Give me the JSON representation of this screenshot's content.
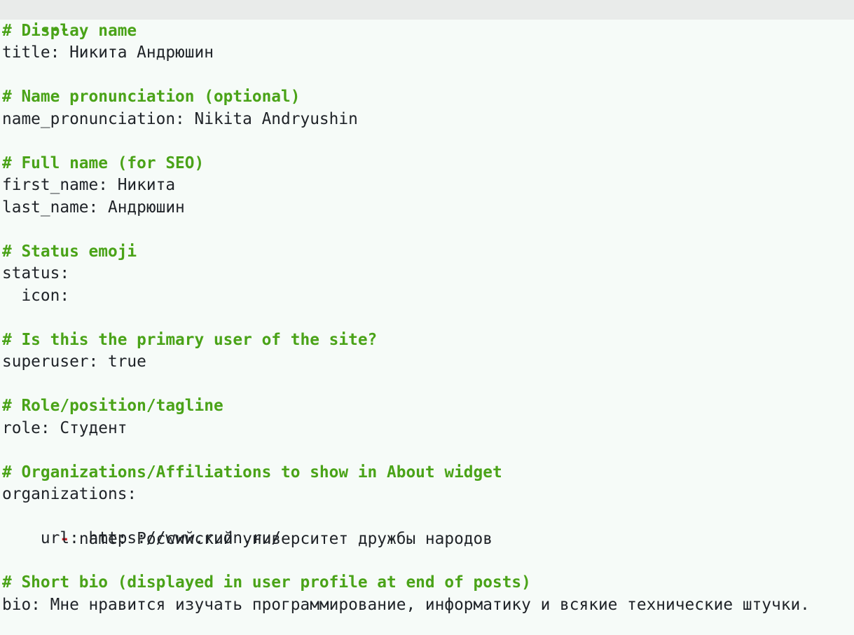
{
  "frontmatter_delimiter": "---",
  "lines": {
    "c_display_name": "# Display name",
    "title": "title: Никита Андрюшин",
    "c_pronunciation": "# Name pronunciation (optional)",
    "name_pronunciation": "name_pronunciation: Nikita Andryushin",
    "c_full_name": "# Full name (for SEO)",
    "first_name": "first_name: Никита",
    "last_name": "last_name: Андрюшин",
    "c_status": "# Status emoji",
    "status": "status:",
    "icon": "  icon:",
    "c_primary": "# Is this the primary user of the site?",
    "superuser": "superuser: true",
    "c_role": "# Role/position/tagline",
    "role": "role: Студент",
    "c_orgs": "# Organizations/Affiliations to show in About widget",
    "organizations": "organizations:",
    "org_dash": "  -",
    "org_name": " name: Российский университет дружбы народов",
    "org_url": "    url: https://www.rudn.ru/",
    "c_bio": "# Short bio (displayed in user profile at end of posts)",
    "bio": "bio: Мне нравится изучать программирование, информатику и всякие технические штучки."
  }
}
